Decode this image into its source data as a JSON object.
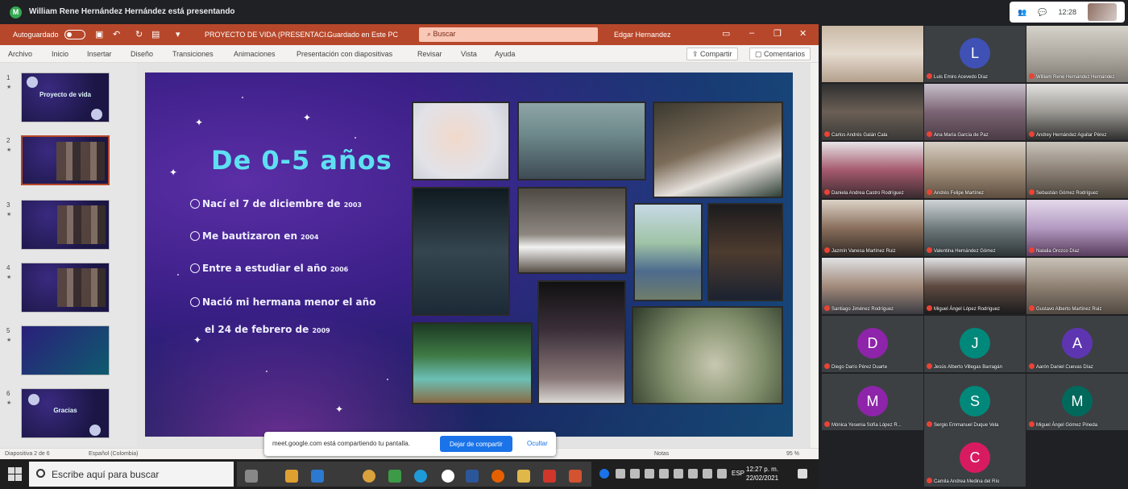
{
  "presenting": {
    "message": "William Rene Hernández Hernández está presentando"
  },
  "meet_controls": {
    "time": "12:28"
  },
  "ppt": {
    "autosave_label": "Autoguardado",
    "document_title": "PROYECTO DE VIDA (PRESENTACI...",
    "saved_status": "Guardado en Este PC",
    "search_placeholder": "Buscar",
    "user_name": "Edgar Hernandez",
    "tabs": [
      "Archivo",
      "Inicio",
      "Insertar",
      "Diseño",
      "Transiciones",
      "Animaciones",
      "Presentación con diapositivas",
      "Revisar",
      "Vista",
      "Ayuda"
    ],
    "share_label": "Compartir",
    "comments_label": "Comentarios",
    "thumbnails": [
      {
        "num": "1",
        "title": "Proyecto de vida"
      },
      {
        "num": "2",
        "title": ""
      },
      {
        "num": "3",
        "title": ""
      },
      {
        "num": "4",
        "title": ""
      },
      {
        "num": "5",
        "title": ""
      },
      {
        "num": "6",
        "title": "Gracias"
      }
    ],
    "slide": {
      "title": "De 0-5 años",
      "b1": "Nací el 7 de diciembre de",
      "b1_year": "2003",
      "b2": "Me bautizaron en",
      "b2_year": "2004",
      "b3": "Entre a estudiar el año",
      "b3_year": "2006",
      "b4": "Nació mi hermana menor el año",
      "b5": "el 24 de febrero de",
      "b5_year": "2009"
    },
    "status": {
      "slide_of": "Diapositiva 2 de 6",
      "language": "Español (Colombia)",
      "notes": "Notas",
      "zoom": "95 %"
    }
  },
  "share_notification": {
    "text": "meet.google.com está compartiendo tu pantalla.",
    "stop_label": "Dejar de compartir",
    "hide_label": "Ocultar"
  },
  "taskbar": {
    "search_placeholder": "Escribe aquí para buscar",
    "time": "12:27 p. m.",
    "date": "22/02/2021",
    "lang": "ESP"
  },
  "participants": [
    {
      "name": "",
      "avatar": "",
      "color": ""
    },
    {
      "name": "Luis Emiro Acevedo Díaz",
      "avatar": "L",
      "color": "#3f51b5"
    },
    {
      "name": "William Rene Hernández Hernández",
      "avatar": "",
      "color": ""
    },
    {
      "name": "Carlos Andrés Galán Cala",
      "avatar": "",
      "color": ""
    },
    {
      "name": "Ana María García de Paz",
      "avatar": "",
      "color": ""
    },
    {
      "name": "Andrey Hernández Aguilar Pérez",
      "avatar": "",
      "color": ""
    },
    {
      "name": "Daniela Andrea Castro Rodríguez",
      "avatar": "",
      "color": ""
    },
    {
      "name": "Andrés Felipe Martínez",
      "avatar": "",
      "color": ""
    },
    {
      "name": "Sebastián Gómez Rodríguez",
      "avatar": "",
      "color": ""
    },
    {
      "name": "Jazmín Vanesa Martínez Ruiz",
      "avatar": "",
      "color": ""
    },
    {
      "name": "Valentina Hernández Gómez",
      "avatar": "",
      "color": ""
    },
    {
      "name": "Natalia Orozco Díaz",
      "avatar": "",
      "color": ""
    },
    {
      "name": "Santiago Jiménez Rodríguez",
      "avatar": "",
      "color": ""
    },
    {
      "name": "Miguel Ángel López Rodríguez",
      "avatar": "",
      "color": ""
    },
    {
      "name": "Gustavo Alberto Martínez Ruiz",
      "avatar": "",
      "color": ""
    },
    {
      "name": "Diego Darío Pérez Duarte",
      "avatar": "D",
      "color": "#8e24aa"
    },
    {
      "name": "Jesús Alberto Villegas Barragán",
      "avatar": "J",
      "color": "#00897b"
    },
    {
      "name": "Aarón Daniel Cuevas Díaz",
      "avatar": "A",
      "color": "#5e35b1"
    },
    {
      "name": "Mónica Yesenia Sofía López R...",
      "avatar": "M",
      "color": "#8e24aa"
    },
    {
      "name": "Sergio Emmanuel Duque Vela",
      "avatar": "S",
      "color": "#00897b"
    },
    {
      "name": "Miguel Ángel Gómez Pineda",
      "avatar": "M",
      "color": "#00695c"
    },
    {
      "name": "Camila Andrea Medina del Río",
      "avatar": "C",
      "color": "#d81b60"
    }
  ]
}
